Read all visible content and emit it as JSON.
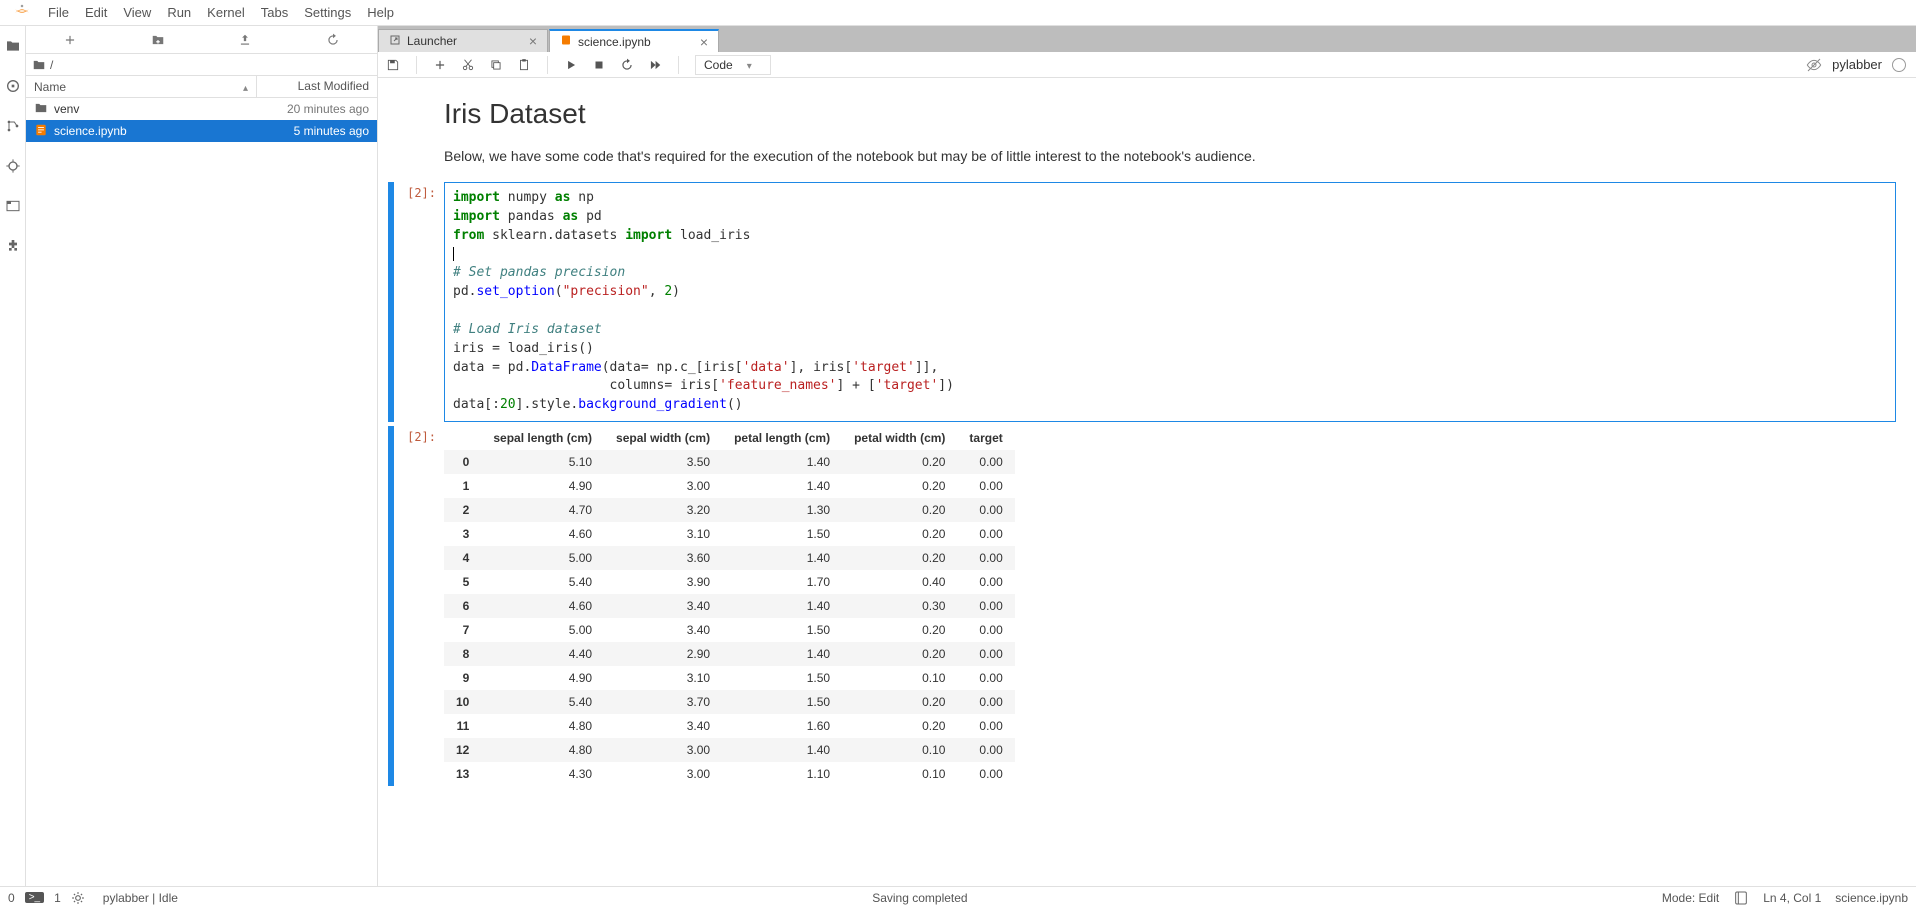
{
  "menubar": [
    "File",
    "Edit",
    "View",
    "Run",
    "Kernel",
    "Tabs",
    "Settings",
    "Help"
  ],
  "file_toolbar": {
    "new": "plus",
    "newfolder": "folder+",
    "upload": "upload",
    "refresh": "refresh"
  },
  "breadcrumb": "/",
  "file_header": {
    "name": "Name",
    "modified": "Last Modified"
  },
  "files": [
    {
      "icon": "folder",
      "name": "venv",
      "modified": "20 minutes ago",
      "selected": false
    },
    {
      "icon": "notebook",
      "name": "science.ipynb",
      "modified": "5 minutes ago",
      "selected": true
    }
  ],
  "tabs": [
    {
      "icon": "launcher",
      "label": "Launcher",
      "active": false
    },
    {
      "icon": "notebook",
      "label": "science.ipynb",
      "active": true
    }
  ],
  "nb_toolbar": {
    "celltype": "Code",
    "kernel_name": "pylabber"
  },
  "notebook": {
    "title_heading": "Iris Dataset",
    "intro_text": "Below, we have some code that's required for the execution of the notebook but may be of little interest to the notebook's audience.",
    "code_prompt": "[2]:",
    "out_prompt": "[2]:",
    "table_headers": [
      "",
      "sepal length (cm)",
      "sepal width (cm)",
      "petal length (cm)",
      "petal width (cm)",
      "target"
    ],
    "table_rows": [
      [
        "0",
        "5.10",
        "3.50",
        "1.40",
        "0.20",
        "0.00"
      ],
      [
        "1",
        "4.90",
        "3.00",
        "1.40",
        "0.20",
        "0.00"
      ],
      [
        "2",
        "4.70",
        "3.20",
        "1.30",
        "0.20",
        "0.00"
      ],
      [
        "3",
        "4.60",
        "3.10",
        "1.50",
        "0.20",
        "0.00"
      ],
      [
        "4",
        "5.00",
        "3.60",
        "1.40",
        "0.20",
        "0.00"
      ],
      [
        "5",
        "5.40",
        "3.90",
        "1.70",
        "0.40",
        "0.00"
      ],
      [
        "6",
        "4.60",
        "3.40",
        "1.40",
        "0.30",
        "0.00"
      ],
      [
        "7",
        "5.00",
        "3.40",
        "1.50",
        "0.20",
        "0.00"
      ],
      [
        "8",
        "4.40",
        "2.90",
        "1.40",
        "0.20",
        "0.00"
      ],
      [
        "9",
        "4.90",
        "3.10",
        "1.50",
        "0.10",
        "0.00"
      ],
      [
        "10",
        "5.40",
        "3.70",
        "1.50",
        "0.20",
        "0.00"
      ],
      [
        "11",
        "4.80",
        "3.40",
        "1.60",
        "0.20",
        "0.00"
      ],
      [
        "12",
        "4.80",
        "3.00",
        "1.40",
        "0.10",
        "0.00"
      ],
      [
        "13",
        "4.30",
        "3.00",
        "1.10",
        "0.10",
        "0.00"
      ]
    ]
  },
  "code_tokens": [
    [
      [
        "kw",
        "import"
      ],
      [
        "",
        " numpy "
      ],
      [
        "kw",
        "as"
      ],
      [
        "",
        " np"
      ]
    ],
    [
      [
        "kw",
        "import"
      ],
      [
        "",
        " pandas "
      ],
      [
        "kw",
        "as"
      ],
      [
        "",
        " pd"
      ]
    ],
    [
      [
        "kw",
        "from"
      ],
      [
        "",
        " sklearn.datasets "
      ],
      [
        "kw",
        "import"
      ],
      [
        "",
        " load_iris"
      ]
    ],
    [
      [
        "",
        ""
      ]
    ],
    [
      [
        "cm",
        "# Set pandas precision"
      ]
    ],
    [
      [
        "",
        "pd."
      ],
      [
        "fn",
        "set_option"
      ],
      [
        "",
        "("
      ],
      [
        "str",
        "\"precision\""
      ],
      [
        "",
        ", "
      ],
      [
        "num",
        "2"
      ],
      [
        "",
        ")"
      ]
    ],
    [
      [
        "",
        ""
      ]
    ],
    [
      [
        "cm",
        "# Load Iris dataset"
      ]
    ],
    [
      [
        "",
        "iris = load_iris()"
      ]
    ],
    [
      [
        "",
        "data = pd."
      ],
      [
        "fn",
        "DataFrame"
      ],
      [
        "",
        "(data= np.c_[iris["
      ],
      [
        "str",
        "'data'"
      ],
      [
        "",
        "], iris["
      ],
      [
        "str",
        "'target'"
      ],
      [
        "",
        "]],"
      ]
    ],
    [
      [
        "",
        "                    columns= iris["
      ],
      [
        "str",
        "'feature_names'"
      ],
      [
        "",
        "] + ["
      ],
      [
        "str",
        "'target'"
      ],
      [
        "",
        "])"
      ]
    ],
    [
      [
        "",
        "data[:"
      ],
      [
        "num",
        "20"
      ],
      [
        "",
        "].style."
      ],
      [
        "fn",
        "background_gradient"
      ],
      [
        "",
        "()"
      ]
    ]
  ],
  "statusbar": {
    "left_items": [
      "0",
      "1"
    ],
    "kernel_status": "pylabber | Idle",
    "center": "Saving completed",
    "mode": "Mode: Edit",
    "cursor": "Ln 4, Col 1",
    "filename": "science.ipynb"
  }
}
